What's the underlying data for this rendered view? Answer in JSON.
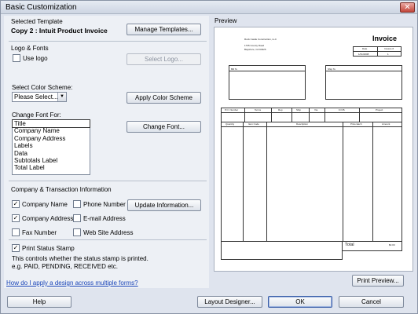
{
  "window": {
    "title": "Basic Customization",
    "close": "✕"
  },
  "left": {
    "selected_template_label": "Selected Template",
    "template_name": "Copy 2 : Intuit Product Invoice",
    "manage_templates": "Manage Templates...",
    "logo_fonts_label": "Logo & Fonts",
    "use_logo_label": "Use logo",
    "use_logo_checked": false,
    "select_logo": "Select Logo...",
    "color_scheme_label": "Select Color Scheme:",
    "color_scheme_value": "Please Select...",
    "apply_color_scheme": "Apply Color Scheme",
    "change_font_label": "Change Font For:",
    "font_items": [
      "Title",
      "Company Name",
      "Company Address",
      "Labels",
      "Data",
      "Subtotals Label",
      "Total Label"
    ],
    "change_font": "Change Font...",
    "company_info_label": "Company & Transaction Information",
    "company_name": "Company Name",
    "company_name_checked": true,
    "phone_number": "Phone Number",
    "phone_number_checked": false,
    "update_information": "Update Information...",
    "company_address": "Company Address",
    "company_address_checked": true,
    "email_address": "E-mail Address",
    "email_address_checked": false,
    "fax_number": "Fax Number",
    "fax_number_checked": false,
    "web_site_address": "Web Site Address",
    "web_site_address_checked": false,
    "print_status_stamp": "Print Status Stamp",
    "print_status_stamp_checked": true,
    "status_note_1": "This controls whether the status stamp is printed.",
    "status_note_2": "e.g. PAID, PENDING, RECEIVED etc.",
    "help_link": "How do I apply a design across multiple forms?"
  },
  "preview": {
    "label": "Preview",
    "company_line1": "Rock Castle Construction, LLC",
    "company_line2": "1735 County Road",
    "company_line3": "Bayshore, CA 94326",
    "invoice_title": "Invoice",
    "date_header": "Date",
    "invoice_no_header": "Invoice #",
    "date_value": "1/31/2008",
    "invoice_no_value": "1",
    "bill_to": "Bill To",
    "ship_to": "Ship To",
    "row_headers": [
      "P.O. Number",
      "Terms",
      "Rep",
      "Ship",
      "Via",
      "F.O.B.",
      "Project"
    ],
    "item_headers": [
      "Quantity",
      "Item Code",
      "Description",
      "Price Each",
      "Amount"
    ],
    "total_label": "Total",
    "total_value": "$0.00",
    "print_preview": "Print Preview..."
  },
  "footer": {
    "help": "Help",
    "layout_designer": "Layout Designer...",
    "ok": "OK",
    "cancel": "Cancel"
  }
}
